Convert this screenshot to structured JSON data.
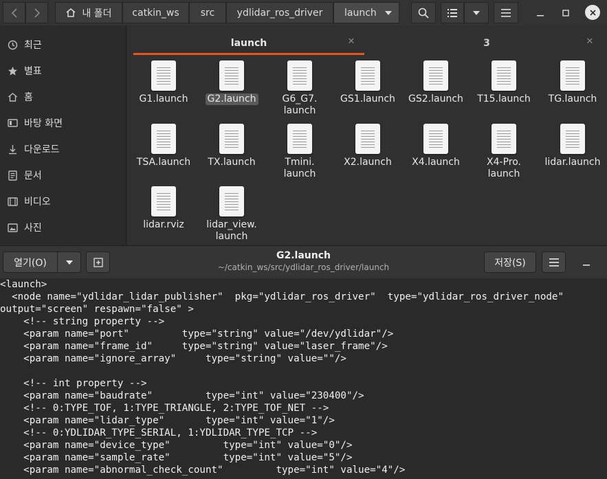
{
  "toolbar": {
    "back_icon": "chevron-left-icon",
    "forward_icon": "chevron-right-icon",
    "breadcrumbs": [
      "내 폴더",
      "catkin_ws",
      "src",
      "ydlidar_ros_driver",
      "launch"
    ]
  },
  "sidebar": {
    "items": [
      {
        "label": "최근",
        "icon": "clock-icon"
      },
      {
        "label": "별표",
        "icon": "star-icon"
      },
      {
        "label": "홈",
        "icon": "home-icon"
      },
      {
        "label": "바탕 화면",
        "icon": "desktop-icon"
      },
      {
        "label": "다운로드",
        "icon": "download-icon"
      },
      {
        "label": "문서",
        "icon": "document-icon"
      },
      {
        "label": "비디오",
        "icon": "video-icon"
      },
      {
        "label": "사진",
        "icon": "picture-icon"
      }
    ]
  },
  "tabs": [
    {
      "label": "launch",
      "active": true
    },
    {
      "label": "3",
      "active": false
    }
  ],
  "files": [
    {
      "name": "G1.launch"
    },
    {
      "name": "G2.launch",
      "selected": true
    },
    {
      "name": "G6_G7.\nlaunch"
    },
    {
      "name": "GS1.launch"
    },
    {
      "name": "GS2.launch"
    },
    {
      "name": "T15.launch"
    },
    {
      "name": "TG.launch"
    },
    {
      "name": "TSA.launch"
    },
    {
      "name": "TX.launch"
    },
    {
      "name": "Tmini.\nlaunch"
    },
    {
      "name": "X2.launch"
    },
    {
      "name": "X4.launch"
    },
    {
      "name": "X4-Pro.\nlaunch"
    },
    {
      "name": "lidar.launch"
    },
    {
      "name": "lidar.rviz"
    },
    {
      "name": "lidar_view.\nlaunch"
    }
  ],
  "editor": {
    "open_label": "열기(O)",
    "save_label": "저장(S)",
    "title": "G2.launch",
    "path": "~/catkin_ws/src/ydlidar_ros_driver/launch",
    "lines": [
      "<launch>",
      "  <node name=\"ydlidar_lidar_publisher\"  pkg=\"ydlidar_ros_driver\"  type=\"ydlidar_ros_driver_node\"",
      "output=\"screen\" respawn=\"false\" >",
      "    <!-- string property -->",
      "    <param name=\"port\"         type=\"string\" value=\"/dev/ydlidar\"/>",
      "    <param name=\"frame_id\"     type=\"string\" value=\"laser_frame\"/>",
      "    <param name=\"ignore_array\"     type=\"string\" value=\"\"/>",
      "",
      "    <!-- int property -->",
      "    <param name=\"baudrate\"         type=\"int\" value=\"230400\"/>",
      "    <!-- 0:TYPE_TOF, 1:TYPE_TRIANGLE, 2:TYPE_TOF_NET -->",
      "    <param name=\"lidar_type\"       type=\"int\" value=\"1\"/>",
      "    <!-- 0:YDLIDAR_TYPE_SERIAL, 1:YDLIDAR_TYPE_TCP -->",
      "    <param name=\"device_type\"         type=\"int\" value=\"0\"/>",
      "    <param name=\"sample_rate\"         type=\"int\" value=\"5\"/>",
      "    <param name=\"abnormal_check_count\"         type=\"int\" value=\"4\"/>"
    ]
  }
}
